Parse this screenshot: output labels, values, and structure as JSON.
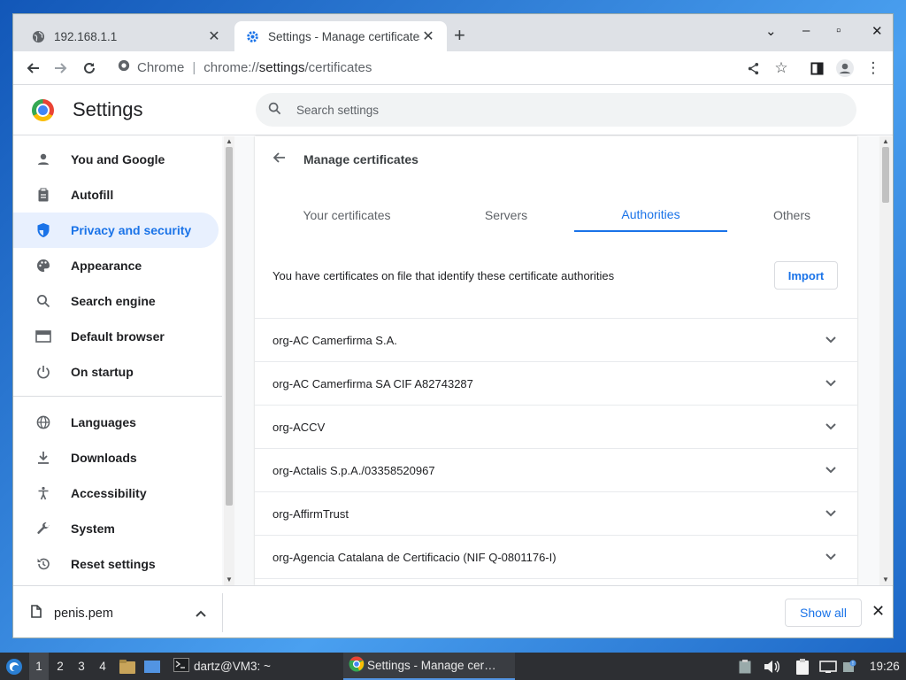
{
  "browser": {
    "tabs": [
      {
        "title": "192.168.1.1",
        "icon": "globe-icon"
      },
      {
        "title": "Settings - Manage certificates",
        "icon": "gear-icon"
      }
    ],
    "omnibox": {
      "label": "Chrome",
      "url_prefix": "chrome://",
      "url_host": "settings",
      "url_path": "/certificates"
    }
  },
  "settings": {
    "title": "Settings",
    "search_placeholder": "Search settings",
    "nav": [
      {
        "label": "You and Google",
        "icon": "person-icon"
      },
      {
        "label": "Autofill",
        "icon": "clipboard-icon"
      },
      {
        "label": "Privacy and security",
        "icon": "shield-icon",
        "selected": true
      },
      {
        "label": "Appearance",
        "icon": "palette-icon"
      },
      {
        "label": "Search engine",
        "icon": "search-icon"
      },
      {
        "label": "Default browser",
        "icon": "browser-icon"
      },
      {
        "label": "On startup",
        "icon": "power-icon"
      },
      {
        "label": "Languages",
        "icon": "globe-icon"
      },
      {
        "label": "Downloads",
        "icon": "download-icon"
      },
      {
        "label": "Accessibility",
        "icon": "accessibility-icon"
      },
      {
        "label": "System",
        "icon": "wrench-icon"
      },
      {
        "label": "Reset settings",
        "icon": "reset-icon"
      }
    ],
    "page": {
      "title": "Manage certificates",
      "tabs": [
        "Your certificates",
        "Servers",
        "Authorities",
        "Others"
      ],
      "selected_tab": "Authorities",
      "description": "You have certificates on file that identify these certificate authorities",
      "import_label": "Import",
      "certificates": [
        "org-AC Camerfirma S.A.",
        "org-AC Camerfirma SA CIF A82743287",
        "org-ACCV",
        "org-Actalis S.p.A./03358520967",
        "org-AffirmTrust",
        "org-Agencia Catalana de Certificacio (NIF Q-0801176-I)"
      ]
    }
  },
  "downloads": {
    "file": "penis.pem",
    "show_all": "Show all"
  },
  "taskbar": {
    "workspaces": [
      "1",
      "2",
      "3",
      "4"
    ],
    "terminal": "dartz@VM3: ~",
    "active_window": "Settings - Manage cer…",
    "clock": "19:26"
  },
  "colors": {
    "accent": "#1a73e8",
    "selected_bg": "#e8f0fe"
  }
}
